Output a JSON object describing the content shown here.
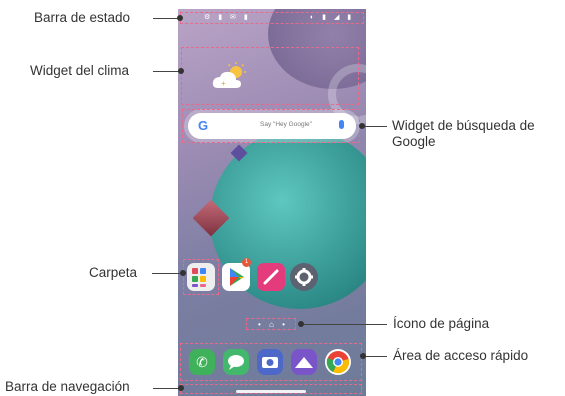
{
  "callouts": {
    "status_bar": "Barra de estado",
    "weather_widget": "Widget del clima",
    "google_search_widget": "Widget de búsqueda de Google",
    "folder": "Carpeta",
    "page_icon": "Ícono de página",
    "quick_access": "Área de acceso rápido",
    "navigation_bar": "Barra de navegación"
  },
  "screen": {
    "search_placeholder": "Say \"Hey Google\"",
    "google_letter": "G",
    "badge_count": "1"
  },
  "colors": {
    "highlight": "#e86a8a",
    "accent_teal": "#2d8b88"
  },
  "icons": [
    "weather-icon",
    "folder-icon",
    "play-store-icon",
    "pen-icon",
    "settings-icon",
    "phone-icon",
    "messages-icon",
    "camera-icon",
    "gallery-icon",
    "chrome-icon"
  ]
}
